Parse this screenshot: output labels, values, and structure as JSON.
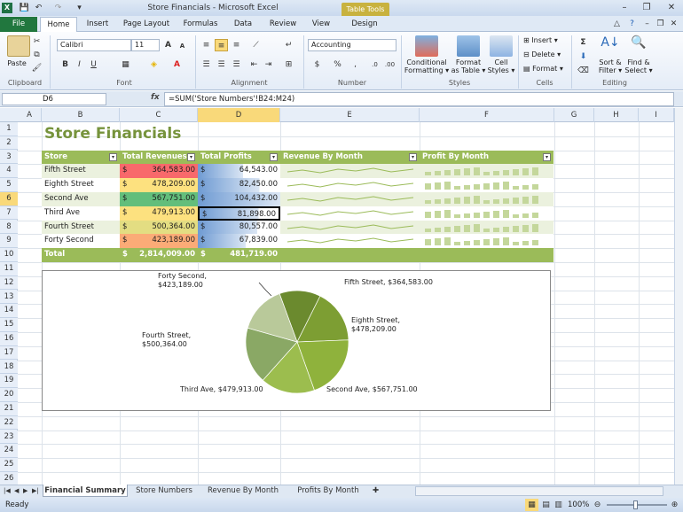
{
  "window": {
    "title": "Store Financials - Microsoft Excel",
    "context_tab": "Table Tools"
  },
  "ribbon_tabs": [
    "File",
    "Home",
    "Insert",
    "Page Layout",
    "Formulas",
    "Data",
    "Review",
    "View",
    "Design"
  ],
  "ribbon": {
    "clipboard": {
      "label": "Clipboard",
      "paste": "Paste"
    },
    "font": {
      "label": "Font",
      "name": "Calibri",
      "size": "11"
    },
    "alignment": {
      "label": "Alignment"
    },
    "number": {
      "label": "Number",
      "format": "Accounting"
    },
    "styles": {
      "label": "Styles",
      "cond": "Conditional Formatting",
      "cond1": "Conditional",
      "cond2": "Formatting ▾",
      "fmt_table1": "Format",
      "fmt_table2": "as Table ▾",
      "cell_styles1": "Cell",
      "cell_styles2": "Styles ▾"
    },
    "cells": {
      "label": "Cells",
      "insert": "Insert ▾",
      "delete": "Delete ▾",
      "format": "Format ▾"
    },
    "editing": {
      "label": "Editing",
      "sort1": "Sort &",
      "sort2": "Filter ▾",
      "find1": "Find &",
      "find2": "Select ▾"
    }
  },
  "formula_bar": {
    "name_box": "D6",
    "formula": "=SUM('Store Numbers'!B24:M24)"
  },
  "columns": [
    "A",
    "B",
    "C",
    "D",
    "E",
    "F",
    "G",
    "H",
    "I"
  ],
  "rows": [
    "1",
    "2",
    "3",
    "4",
    "5",
    "6",
    "7",
    "8",
    "9",
    "10",
    "11",
    "12",
    "13",
    "14",
    "15",
    "16",
    "17",
    "18",
    "19",
    "20",
    "21",
    "22",
    "23",
    "24",
    "25",
    "26"
  ],
  "sheet": {
    "title": "Store Financials",
    "headers": [
      "Store",
      "Total Revenues",
      "Total Profits",
      "Revenue By Month",
      "Profit By Month"
    ],
    "rows": [
      {
        "store": "Fifth Street",
        "revenue": "364,583.00",
        "profit": "64,543.00",
        "rev_color": "#f8696b",
        "profit_bar": 0.55
      },
      {
        "store": "Eighth Street",
        "revenue": "478,209.00",
        "profit": "82,450.00",
        "rev_color": "#fde17f",
        "profit_bar": 0.75
      },
      {
        "store": "Second Ave",
        "revenue": "567,751.00",
        "profit": "104,432.00",
        "rev_color": "#63be7b",
        "profit_bar": 1.0
      },
      {
        "store": "Third Ave",
        "revenue": "479,913.00",
        "profit": "81,898.00",
        "rev_color": "#fde17f",
        "profit_bar": 0.75
      },
      {
        "store": "Fourth Street",
        "revenue": "500,364.00",
        "profit": "80,557.00",
        "rev_color": "#e3dd82",
        "profit_bar": 0.72
      },
      {
        "store": "Forty Second",
        "revenue": "423,189.00",
        "profit": "67,839.00",
        "rev_color": "#fbab77",
        "profit_bar": 0.58
      }
    ],
    "total": {
      "label": "Total",
      "revenue": "2,814,009.00",
      "profit": "481,719.00"
    },
    "currency": "$"
  },
  "chart_data": {
    "type": "pie",
    "categories": [
      "Fifth Street",
      "Eighth Street",
      "Second Ave",
      "Third Ave",
      "Fourth Street",
      "Forty Second"
    ],
    "values": [
      364583,
      478209,
      567751,
      479913,
      500364,
      423189
    ],
    "labels": [
      "Fifth Street,  $364,583.00",
      "Eighth Street,\n$478,209.00",
      "Second Ave,  $567,751.00",
      "Third Ave,  $479,913.00",
      "Fourth Street,\n$500,364.00",
      "Forty Second,\n$423,189.00"
    ],
    "colors": [
      "#6b8a2e",
      "#7d9e33",
      "#8fb23c",
      "#9cbd4e",
      "#8aa865",
      "#b9c99a"
    ]
  },
  "sheet_tabs": [
    "Financial Summary",
    "Store Numbers",
    "Revenue By Month",
    "Profits By Month"
  ],
  "status": {
    "ready": "Ready",
    "zoom": "100%"
  }
}
